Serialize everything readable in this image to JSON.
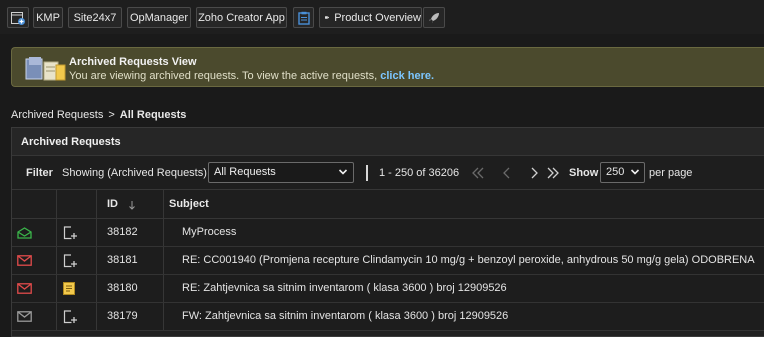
{
  "toolbar": {
    "buttons": [
      {
        "label": "KMP"
      },
      {
        "label": "Site24x7"
      },
      {
        "label": "OpManager"
      },
      {
        "label": "Zoho Creator App"
      },
      {
        "label": "Product Overview"
      }
    ]
  },
  "banner": {
    "title": "Archived Requests View",
    "text": "You are viewing archived requests. To view the active requests,",
    "link": "click here."
  },
  "breadcrumb": {
    "parent": "Archived Requests",
    "separator": ">",
    "current": "All Requests"
  },
  "panel": {
    "title": "Archived Requests",
    "filter_label": "Filter",
    "showing": "Showing (Archived Requests)",
    "view_select": "All Requests",
    "range": "1 - 250 of 36206",
    "show_label": "Show",
    "per_page_value": "250",
    "per_page_label": "per page"
  },
  "table": {
    "columns": {
      "id": "ID",
      "subject": "Subject"
    },
    "rows": [
      {
        "id": "38182",
        "subject": "MyProcess",
        "mail_icon": "open-envelope-icon",
        "mail_color": "#3bb54a",
        "note_icon": "add-note-icon"
      },
      {
        "id": "38181",
        "subject": "RE: CC001940 (Promjena recepture Clindamycin 10 mg/g + benzoyl peroxide, anhydrous 50 mg/g gela) ODOBRENA",
        "mail_icon": "envelope-icon",
        "mail_color": "#e14b4b",
        "note_icon": "add-note-icon"
      },
      {
        "id": "38180",
        "subject": "RE: Zahtjevnica sa sitnim inventarom ( klasa 3600 ) broj 12909526",
        "mail_icon": "envelope-icon",
        "mail_color": "#e14b4b",
        "note_icon": "note-icon"
      },
      {
        "id": "38179",
        "subject": "FW: Zahtjevnica sa sitnim inventarom ( klasa 3600 ) broj 12909526",
        "mail_icon": "envelope-icon",
        "mail_color": "#9a9a9a",
        "note_icon": "add-note-icon"
      }
    ]
  },
  "colors": {
    "link": "#7cc6ff",
    "banner_bg": "#4b4a2d",
    "note_yellow": "#f2c94c"
  }
}
